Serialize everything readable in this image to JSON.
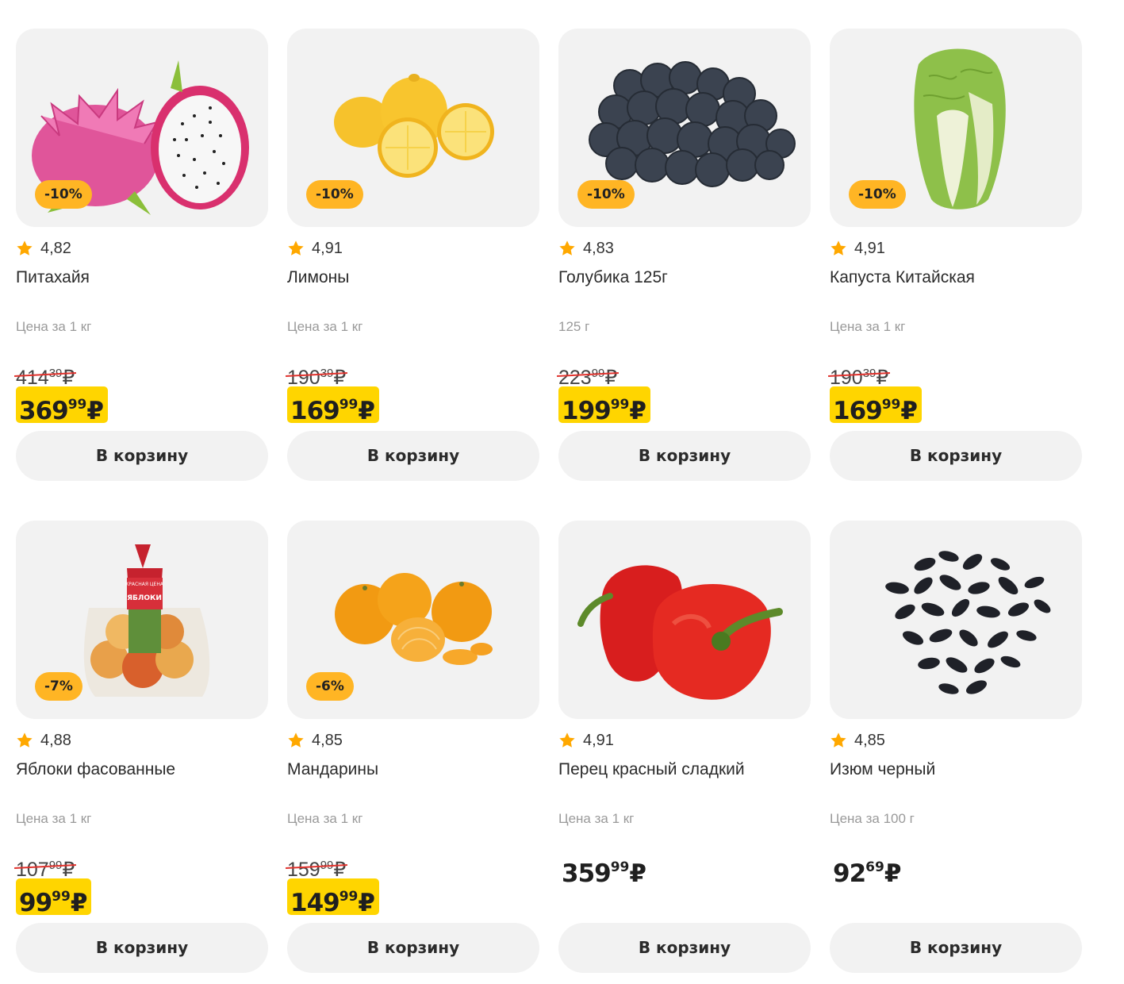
{
  "currency": "₽",
  "products": [
    {
      "name": "Питахайя",
      "rating": "4,82",
      "badge": "-10%",
      "unit": "Цена за 1 кг",
      "old_int": "414",
      "old_cents": "39",
      "price_int": "369",
      "price_cents": "99",
      "cart": "В корзину"
    },
    {
      "name": "Лимоны",
      "rating": "4,91",
      "badge": "-10%",
      "unit": "Цена за 1 кг",
      "old_int": "190",
      "old_cents": "39",
      "price_int": "169",
      "price_cents": "99",
      "cart": "В корзину"
    },
    {
      "name": "Голубика 125г",
      "rating": "4,83",
      "badge": "-10%",
      "unit": "125 г",
      "old_int": "223",
      "old_cents": "99",
      "price_int": "199",
      "price_cents": "99",
      "cart": "В корзину"
    },
    {
      "name": "Капуста Китайская",
      "rating": "4,91",
      "badge": "-10%",
      "unit": "Цена за 1 кг",
      "old_int": "190",
      "old_cents": "39",
      "price_int": "169",
      "price_cents": "99",
      "cart": "В корзину"
    },
    {
      "name": "Яблоки фасованные",
      "rating": "4,88",
      "badge": "-7%",
      "unit": "Цена за 1 кг",
      "old_int": "107",
      "old_cents": "99",
      "price_int": "99",
      "price_cents": "99",
      "cart": "В корзину",
      "package_label": "ЯБЛОКИ",
      "package_brand": "КРАСНАЯ ЦЕНА"
    },
    {
      "name": "Мандарины",
      "rating": "4,85",
      "badge": "-6%",
      "unit": "Цена за 1 кг",
      "old_int": "159",
      "old_cents": "99",
      "price_int": "149",
      "price_cents": "99",
      "cart": "В корзину"
    },
    {
      "name": "Перец красный сладкий",
      "rating": "4,91",
      "unit": "Цена за 1 кг",
      "price_int": "359",
      "price_cents": "99",
      "cart": "В корзину"
    },
    {
      "name": "Изюм черный",
      "rating": "4,85",
      "unit": "Цена за 100 г",
      "price_int": "92",
      "price_cents": "69",
      "cart": "В корзину"
    }
  ],
  "colors": {
    "badge": "#ffb524",
    "sale_price_bg": "#ffd500",
    "strike": "#e0322d",
    "star": "#ffa800",
    "card_bg": "#f2f2f2"
  },
  "icons": {
    "rating": "star-icon"
  }
}
